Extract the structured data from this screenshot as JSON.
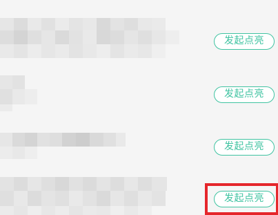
{
  "rows": [
    {
      "action_label": "发起点亮"
    },
    {
      "action_label": "发起点亮"
    },
    {
      "action_label": "发起点亮"
    },
    {
      "action_label": "发起点亮"
    }
  ],
  "colors": {
    "accent": "#3fc3a1",
    "highlight_border": "#e5262b",
    "background": "#f5f5f5"
  }
}
